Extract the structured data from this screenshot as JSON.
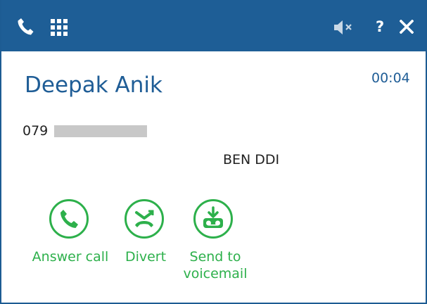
{
  "titlebar": {
    "background": "#1e5e96",
    "icons": [
      "phone-icon",
      "keypad-icon",
      "speaker-mute-icon",
      "help-icon",
      "close-icon"
    ],
    "help_label": "?",
    "close_label": "✕"
  },
  "call": {
    "caller_name": "Deepak Anik",
    "duration": "00:04",
    "number_prefix": "079",
    "ddi_label": "BEN DDI"
  },
  "actions": {
    "answer_label": "Answer call",
    "divert_label": "Divert",
    "voicemail_label_line1": "Send to",
    "voicemail_label_line2": "voicemail",
    "accent": "#2db04b"
  }
}
